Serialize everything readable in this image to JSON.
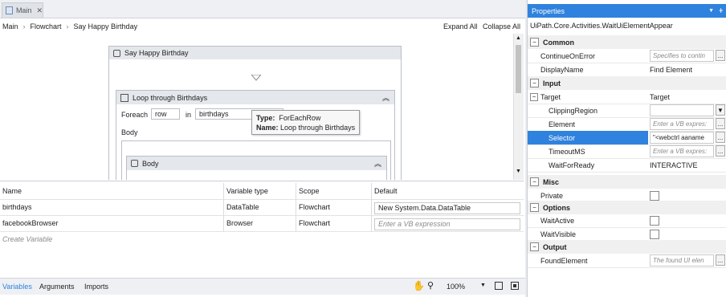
{
  "tab": {
    "label": "Main"
  },
  "breadcrumb": [
    "Main",
    "Flowchart",
    "Say Happy Birthday"
  ],
  "toolbar": {
    "expand_all": "Expand All",
    "collapse_all": "Collapse All"
  },
  "canvas": {
    "sequence_title": "Say Happy Birthday",
    "loop_title": "Loop through Birthdays",
    "foreach_label": "Foreach",
    "foreach_var": "row",
    "in_label": "in",
    "in_value": "birthdays",
    "body_label": "Body",
    "inner_body_title": "Body",
    "tooltip": {
      "type_key": "Type:",
      "type_val": "ForEachRow",
      "name_key": "Name:",
      "name_val": "Loop through Birthdays"
    }
  },
  "variables": {
    "headers": [
      "Name",
      "Variable type",
      "Scope",
      "Default"
    ],
    "rows": [
      {
        "name": "birthdays",
        "type": "DataTable",
        "scope": "Flowchart",
        "default": "New System.Data.DataTable"
      },
      {
        "name": "facebookBrowser",
        "type": "Browser",
        "scope": "Flowchart",
        "default_placeholder": "Enter a VB expression"
      }
    ],
    "create_label": "Create Variable"
  },
  "bottom_tabs": [
    "Variables",
    "Arguments",
    "Imports"
  ],
  "zoom": "100%",
  "properties": {
    "title": "Properties",
    "type_name": "UiPath.Core.Activities.WaitUiElementAppear",
    "cat_common": "Common",
    "continue_on_error": "ContinueOnError",
    "continue_on_error_ph": "Specifies to contin",
    "display_name": "DisplayName",
    "display_name_val": "Find Element",
    "cat_input": "Input",
    "target": "Target",
    "target_val": "Target",
    "clipping_region": "ClippingRegion",
    "element": "Element",
    "element_ph": "Enter a VB expres:",
    "selector": "Selector",
    "selector_val": "\"<webctrl aaname",
    "timeout": "TimeoutMS",
    "timeout_ph": "Enter a VB expres:",
    "wait_for_ready": "WaitForReady",
    "wait_for_ready_val": "INTERACTIVE",
    "cat_misc": "Misc",
    "private": "Private",
    "cat_options": "Options",
    "wait_active": "WaitActive",
    "wait_visible": "WaitVisible",
    "cat_output": "Output",
    "found_element": "FoundElement",
    "found_element_ph": "The found UI elen"
  },
  "colors": {
    "accent": "#2f82dd",
    "header_bg": "#e4e7eb"
  }
}
